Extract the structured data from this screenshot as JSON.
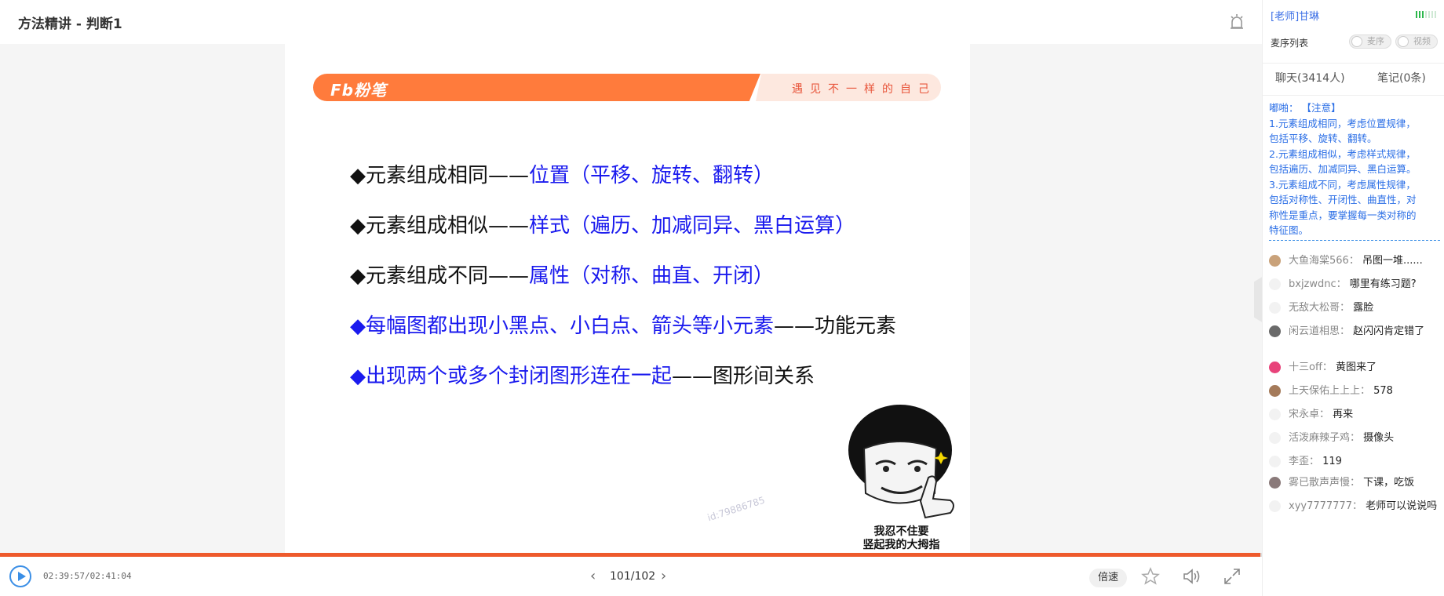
{
  "header": {
    "title": "方法精讲 - 判断1"
  },
  "slide": {
    "logo": "Fb粉笔",
    "slogan": "遇见不一样的自己",
    "bullets": [
      {
        "black": "◆元素组成相同——",
        "blue": "位置（平移、旋转、翻转）"
      },
      {
        "black": "◆元素组成相似——",
        "blue": "样式（遍历、加减同异、黑白运算）"
      },
      {
        "black": "◆元素组成不同——",
        "blue": "属性（对称、曲直、开闭）"
      },
      {
        "blue": "◆每幅图都出现小黑点、小白点、箭头等小元素",
        "black": "——功能元素"
      },
      {
        "blue": "◆出现两个或多个封闭图形连在一起",
        "black": "——图形间关系"
      }
    ],
    "watermark": "id:79886785",
    "meme_caption_1": "我忍不住要",
    "meme_caption_2": "竖起我的大拇指"
  },
  "player": {
    "progress_fraction": 0.9986,
    "time_text": "02:39:57/02:41:04",
    "page_text": "101/102",
    "speed_label": "倍速",
    "accent": "#ee5a2c"
  },
  "sidebar": {
    "teacher": "[老师]甘琳",
    "mic_queue_label": "麦序列表",
    "toggle_mic": "麦序",
    "toggle_video": "视频",
    "tab_chat": "聊天(3414人)",
    "tab_notes": "笔记(0条)",
    "notice_lines": [
      "嘟啪：  【注意】",
      "1.元素组成相同，考虑位置规律，",
      "包括平移、旋转、翻转。",
      "2.元素组成相似，考虑样式规律，",
      "包括遍历、加减同异、黑白运算。",
      "3.元素组成不同，考虑属性规律，",
      "包括对称性、开闭性、曲直性，对",
      "称性是重点，要掌握每一类对称的",
      "特征图。"
    ],
    "chat": [
      {
        "name": "大鱼海棠566：",
        "msg": "吊图一堆......",
        "avatar": "#c9a27a"
      },
      {
        "name": "bxjzwdnc：",
        "msg": "哪里有练习题?",
        "avatar": "#f2f2f2"
      },
      {
        "name": "无敌大松哥：",
        "msg": "露脸",
        "avatar": "#f2f2f2"
      },
      {
        "name": "闲云道相思：",
        "msg": "赵闪闪肯定错了",
        "avatar": "#6a6a6a"
      },
      {
        "name": "十三off：",
        "msg": "黄图来了",
        "avatar": "#e8437a"
      },
      {
        "name": "上天保佑上上上：",
        "msg": "578",
        "avatar": "#a47a5a"
      },
      {
        "name": "宋永卓：",
        "msg": "再来",
        "avatar": "#f2f2f2"
      },
      {
        "name": "活泼麻辣子鸡：",
        "msg": "摄像头",
        "avatar": "#f2f2f2"
      },
      {
        "name": "李歪：",
        "msg": "119",
        "avatar": "#f2f2f2"
      },
      {
        "name": "雾已散声声慢：",
        "msg": "下课，吃饭",
        "avatar": "#8a7a7a"
      },
      {
        "name": "xyy7777777：",
        "msg": "老师可以说说吗",
        "avatar": "#f2f2f2"
      }
    ]
  }
}
